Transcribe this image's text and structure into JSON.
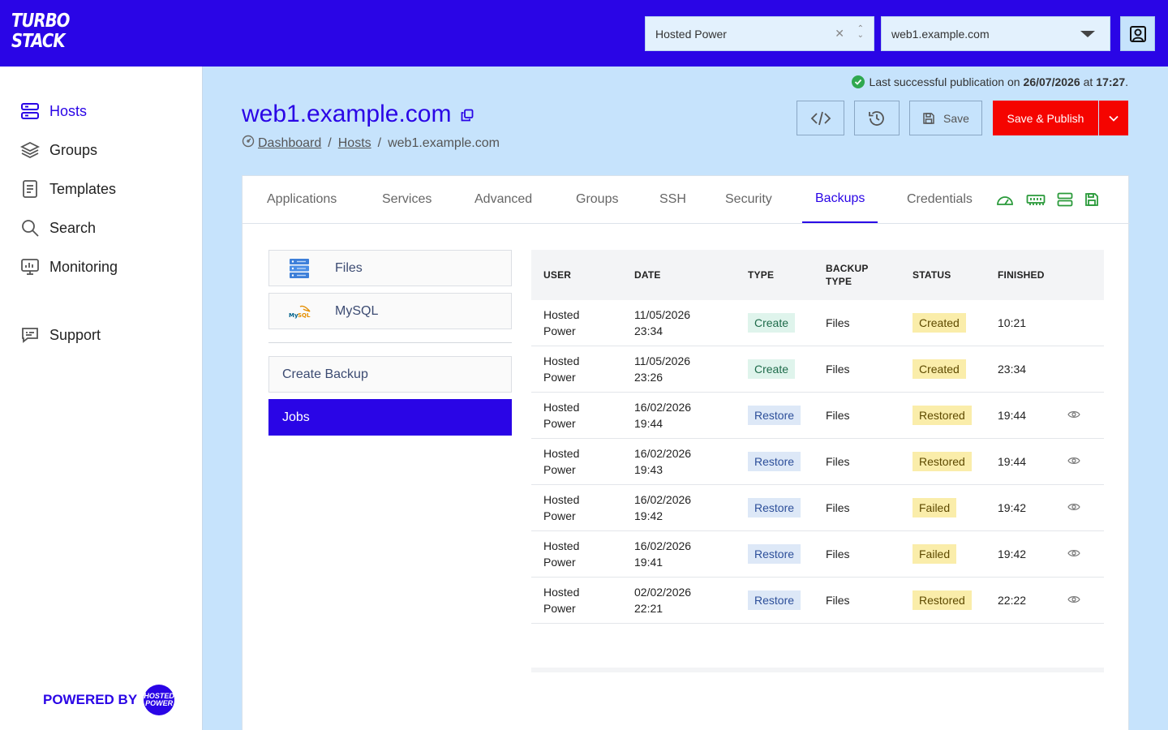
{
  "app": {
    "logo_line1": "TURBO",
    "logo_line2": "STACK"
  },
  "header": {
    "org_select": "Hosted Power",
    "host_select": "web1.example.com"
  },
  "sidebar": {
    "items": [
      {
        "label": "Hosts",
        "icon": "server-icon",
        "active": true
      },
      {
        "label": "Groups",
        "icon": "layers-icon"
      },
      {
        "label": "Templates",
        "icon": "document-icon"
      },
      {
        "label": "Search",
        "icon": "search-icon"
      },
      {
        "label": "Monitoring",
        "icon": "monitor-icon"
      },
      {
        "label": "Support",
        "icon": "chat-icon"
      }
    ],
    "powered_by": "POWERED BY",
    "powered_logo": "HOSTED POWER"
  },
  "publication": {
    "prefix": "Last successful publication on",
    "date": "26/07/2026",
    "at": "at",
    "time": "17:27",
    "suffix": "."
  },
  "page": {
    "title": "web1.example.com",
    "breadcrumb": [
      "Dashboard",
      "Hosts",
      "web1.example.com"
    ]
  },
  "toolbar": {
    "save_label": "Save",
    "publish_label": "Save & Publish"
  },
  "tabs": [
    "Applications",
    "Services",
    "Advanced",
    "Groups",
    "SSH",
    "Security",
    "Backups",
    "Credentials"
  ],
  "active_tab": "Backups",
  "backup_side": {
    "sources": [
      "Files",
      "MySQL"
    ],
    "create_label": "Create Backup",
    "jobs_label": "Jobs"
  },
  "table": {
    "headers": {
      "user": "USER",
      "date": "DATE",
      "type": "TYPE",
      "backup_type_1": "BACKUP",
      "backup_type_2": "TYPE",
      "status": "STATUS",
      "finished": "FINISHED"
    },
    "rows": [
      {
        "user1": "Hosted",
        "user2": "Power",
        "date1": "11/05/2026",
        "date2": "23:34",
        "type": "Create",
        "backup_type": "Files",
        "status": "Created",
        "finished": "10:21",
        "view": false
      },
      {
        "user1": "Hosted",
        "user2": "Power",
        "date1": "11/05/2026",
        "date2": "23:26",
        "type": "Create",
        "backup_type": "Files",
        "status": "Created",
        "finished": "23:34",
        "view": false
      },
      {
        "user1": "Hosted",
        "user2": "Power",
        "date1": "16/02/2026",
        "date2": "19:44",
        "type": "Restore",
        "backup_type": "Files",
        "status": "Restored",
        "finished": "19:44",
        "view": true
      },
      {
        "user1": "Hosted",
        "user2": "Power",
        "date1": "16/02/2026",
        "date2": "19:43",
        "type": "Restore",
        "backup_type": "Files",
        "status": "Restored",
        "finished": "19:44",
        "view": true
      },
      {
        "user1": "Hosted",
        "user2": "Power",
        "date1": "16/02/2026",
        "date2": "19:42",
        "type": "Restore",
        "backup_type": "Files",
        "status": "Failed",
        "finished": "19:42",
        "view": true
      },
      {
        "user1": "Hosted",
        "user2": "Power",
        "date1": "16/02/2026",
        "date2": "19:41",
        "type": "Restore",
        "backup_type": "Files",
        "status": "Failed",
        "finished": "19:42",
        "view": true
      },
      {
        "user1": "Hosted",
        "user2": "Power",
        "date1": "02/02/2026",
        "date2": "22:21",
        "type": "Restore",
        "backup_type": "Files",
        "status": "Restored",
        "finished": "22:22",
        "view": true
      }
    ]
  },
  "colors": {
    "brand": "#2a05e6",
    "publish": "#f50400",
    "background": "#c6e3fc",
    "success": "#2fa84f"
  }
}
